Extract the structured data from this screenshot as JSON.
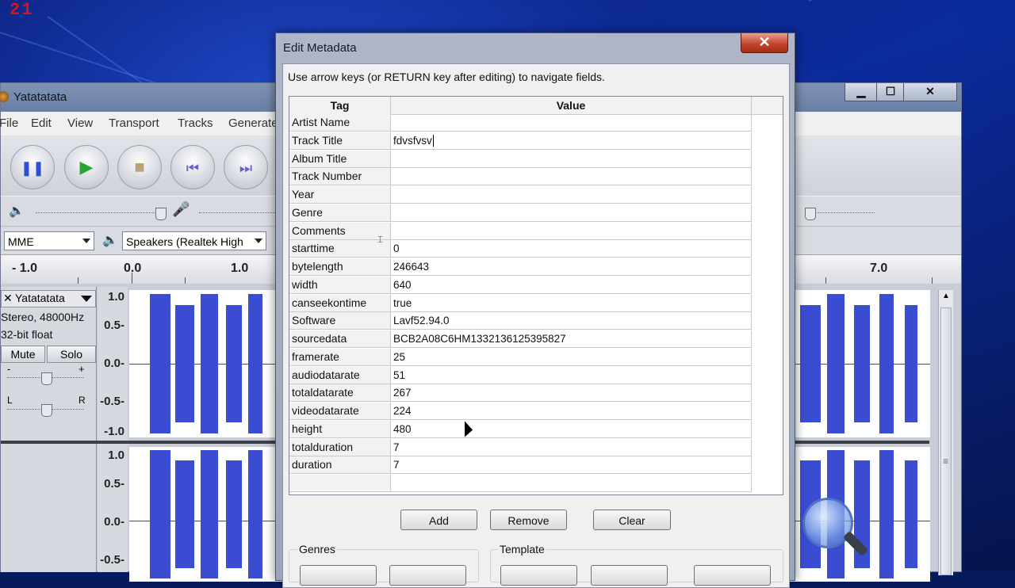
{
  "overlay": {
    "counter": "21"
  },
  "audacity": {
    "title": "Yatatatata",
    "window_buttons": {
      "minimize": "▁",
      "maximize": "☐",
      "close": "✕"
    },
    "menu": [
      "File",
      "Edit",
      "View",
      "Transport",
      "Tracks",
      "Generate"
    ],
    "transport_buttons": [
      {
        "name": "pause",
        "glyph": "❚❚",
        "color": "#2b4fd6"
      },
      {
        "name": "play",
        "glyph": "▶",
        "color": "#27a72e"
      },
      {
        "name": "stop",
        "glyph": "■",
        "color": "#b9a27a"
      },
      {
        "name": "skip-start",
        "glyph": "⏮",
        "color": "#6a5ad6"
      },
      {
        "name": "skip-end",
        "glyph": "⏭",
        "color": "#6a5ad6"
      }
    ],
    "host": "MME",
    "output_device": "Speakers (Realtek High",
    "ruler_labels": [
      "- 1.0",
      "0.0",
      "1.0",
      "7.0"
    ],
    "track": {
      "name": "Yatatatata",
      "format_line1": "Stereo, 48000Hz",
      "format_line2": "32-bit float",
      "mute": "Mute",
      "solo": "Solo",
      "gain_minus": "-",
      "gain_plus": "+",
      "pan_left": "L",
      "pan_right": "R",
      "vruler_top": [
        "1.0",
        "0.5-",
        "0.0-",
        "-0.5-",
        "-1.0"
      ],
      "vruler_bottom": [
        "1.0",
        "0.5-",
        "0.0-",
        "-0.5-"
      ]
    }
  },
  "dialog": {
    "title": "Edit Metadata",
    "close_glyph": "✕",
    "hint": "Use arrow keys (or RETURN key after editing) to navigate fields.",
    "columns": {
      "tag": "Tag",
      "value": "Value"
    },
    "rows": [
      {
        "tag": "Artist Name",
        "value": ""
      },
      {
        "tag": "Track Title",
        "value": "fdvsfvsv"
      },
      {
        "tag": "Album Title",
        "value": ""
      },
      {
        "tag": "Track Number",
        "value": ""
      },
      {
        "tag": "Year",
        "value": ""
      },
      {
        "tag": "Genre",
        "value": ""
      },
      {
        "tag": "Comments",
        "value": ""
      },
      {
        "tag": "starttime",
        "value": "0"
      },
      {
        "tag": "bytelength",
        "value": "246643"
      },
      {
        "tag": "width",
        "value": "640"
      },
      {
        "tag": "canseekontime",
        "value": "true"
      },
      {
        "tag": "Software",
        "value": "Lavf52.94.0"
      },
      {
        "tag": "sourcedata",
        "value": "BCB2A08C6HM1332136125395827"
      },
      {
        "tag": "framerate",
        "value": "25"
      },
      {
        "tag": "audiodatarate",
        "value": "51"
      },
      {
        "tag": "totaldatarate",
        "value": "267"
      },
      {
        "tag": "videodatarate",
        "value": "224"
      },
      {
        "tag": "height",
        "value": "480"
      },
      {
        "tag": "totalduration",
        "value": "7"
      },
      {
        "tag": "duration",
        "value": "7"
      },
      {
        "tag": "",
        "value": ""
      }
    ],
    "editing_row": 1,
    "buttons": {
      "add": "Add",
      "remove": "Remove",
      "clear": "Clear"
    },
    "groups": {
      "genres": "Genres",
      "template": "Template"
    }
  }
}
